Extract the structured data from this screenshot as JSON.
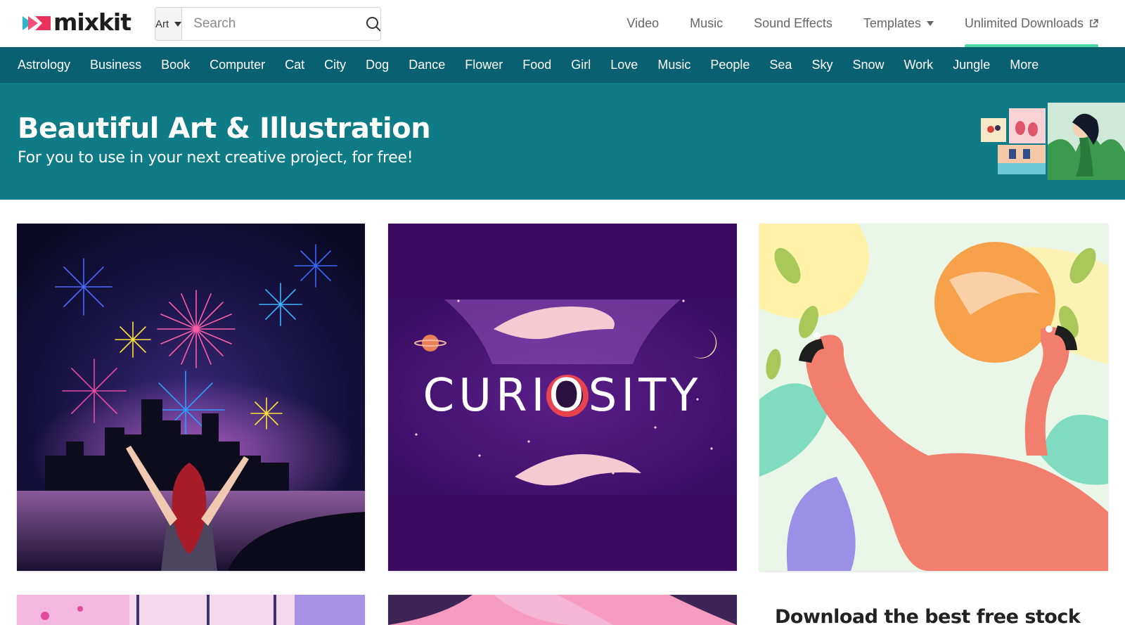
{
  "header": {
    "logo_text": "mixkit",
    "search": {
      "category": "Art",
      "placeholder": "Search"
    },
    "nav": [
      {
        "label": "Video"
      },
      {
        "label": "Music"
      },
      {
        "label": "Sound Effects"
      },
      {
        "label": "Templates"
      },
      {
        "label": "Unlimited Downloads"
      }
    ]
  },
  "categories": [
    "Astrology",
    "Business",
    "Book",
    "Computer",
    "Cat",
    "City",
    "Dog",
    "Dance",
    "Flower",
    "Food",
    "Girl",
    "Love",
    "Music",
    "People",
    "Sea",
    "Sky",
    "Snow",
    "Work",
    "Jungle",
    "More"
  ],
  "hero": {
    "title": "Beautiful Art & Illustration",
    "subtitle": "For you to use in your next creative project, for free!"
  },
  "cards": {
    "curiosity_text": "CURIOSITY"
  },
  "promo": {
    "heading": "Download the best free stock"
  },
  "colors": {
    "category_bar": "#086070",
    "hero_bg": "#0f7b86",
    "active_underline": "#4ad9a0"
  }
}
